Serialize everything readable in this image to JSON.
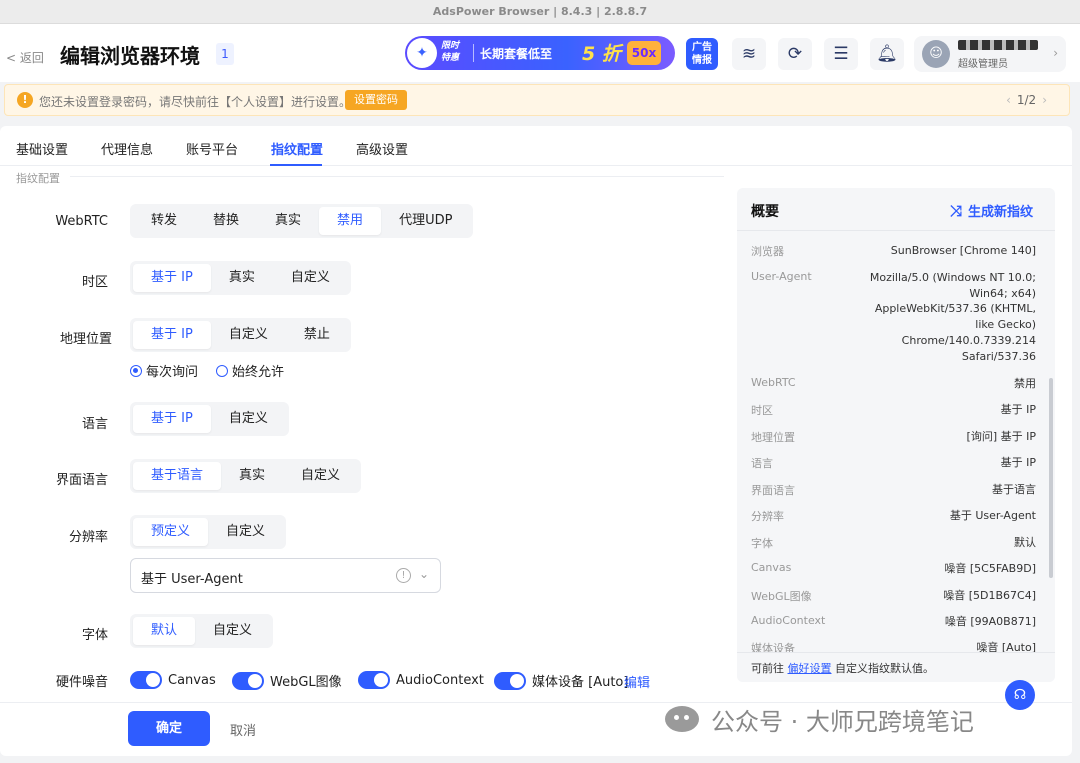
{
  "window": {
    "title": "AdsPower Browser | 8.4.3 | 2.8.8.7"
  },
  "header": {
    "back_label": "< 返回",
    "page_title": "编辑浏览器环境",
    "count_badge": "1",
    "promo": {
      "tag_line1": "限时",
      "tag_line2": "特惠",
      "text": "长期套餐低至",
      "highlight": "5 折",
      "badge": "50x"
    },
    "ad_label_line1": "广告",
    "ad_label_line2": "情报",
    "user": {
      "role": "超级管理员"
    }
  },
  "notice": {
    "text": "您还未设置登录密码，请尽快前往【个人设置】进行设置。",
    "button": "设置密码",
    "pager": "1/2"
  },
  "tabs": [
    "基础设置",
    "代理信息",
    "账号平台",
    "指纹配置",
    "高级设置"
  ],
  "active_tab": "指纹配置",
  "section_title": "指纹配置",
  "fields": {
    "webrtc": {
      "label": "WebRTC",
      "options": [
        "转发",
        "替换",
        "真实",
        "禁用",
        "代理UDP"
      ],
      "selected": "禁用"
    },
    "timezone": {
      "label": "时区",
      "options": [
        "基于 IP",
        "真实",
        "自定义"
      ],
      "selected": "基于 IP"
    },
    "geo": {
      "label": "地理位置",
      "options": [
        "基于 IP",
        "自定义",
        "禁止"
      ],
      "selected": "基于 IP",
      "radio": [
        "每次询问",
        "始终允许"
      ],
      "radio_selected": "每次询问"
    },
    "language": {
      "label": "语言",
      "options": [
        "基于 IP",
        "自定义"
      ],
      "selected": "基于 IP"
    },
    "ui_language": {
      "label": "界面语言",
      "options": [
        "基于语言",
        "真实",
        "自定义"
      ],
      "selected": "基于语言"
    },
    "resolution": {
      "label": "分辨率",
      "options": [
        "预定义",
        "自定义"
      ],
      "selected": "预定义",
      "select_value": "基于 User-Agent"
    },
    "font": {
      "label": "字体",
      "options": [
        "默认",
        "自定义"
      ],
      "selected": "默认"
    },
    "hardware_noise": {
      "label": "硬件噪音",
      "toggles": [
        "Canvas",
        "WebGL图像",
        "AudioContext",
        "媒体设备 [Auto]"
      ],
      "edit": "编辑"
    }
  },
  "actions": {
    "ok": "确定",
    "cancel": "取消"
  },
  "overview": {
    "title": "概要",
    "generate": "生成新指纹",
    "rows": [
      {
        "k": "浏览器",
        "v": "SunBrowser [Chrome 140]"
      },
      {
        "k": "User-Agent",
        "v": "Mozilla/5.0 (Windows NT 10.0; Win64; x64) AppleWebKit/537.36 (KHTML, like Gecko) Chrome/140.0.7339.214 Safari/537.36"
      },
      {
        "k": "WebRTC",
        "v": "禁用"
      },
      {
        "k": "时区",
        "v": "基于 IP"
      },
      {
        "k": "地理位置",
        "v": "[询问] 基于 IP"
      },
      {
        "k": "语言",
        "v": "基于 IP"
      },
      {
        "k": "界面语言",
        "v": "基于语言"
      },
      {
        "k": "分辨率",
        "v": "基于 User-Agent"
      },
      {
        "k": "字体",
        "v": "默认"
      },
      {
        "k": "Canvas",
        "v": "噪音 [5C5FAB9D]"
      },
      {
        "k": "WebGL图像",
        "v": "噪音 [5D1B67C4]"
      },
      {
        "k": "AudioContext",
        "v": "噪音 [99A0B871]"
      },
      {
        "k": "媒体设备",
        "v": "噪音 [Auto]"
      }
    ],
    "footer_prefix": "可前往",
    "footer_link": "偏好设置",
    "footer_suffix": "自定义指纹默认值。"
  },
  "watermark": "公众号 · 大师兄跨境笔记",
  "colors": {
    "accent": "#2f5cff",
    "warning": "#f6a623"
  }
}
